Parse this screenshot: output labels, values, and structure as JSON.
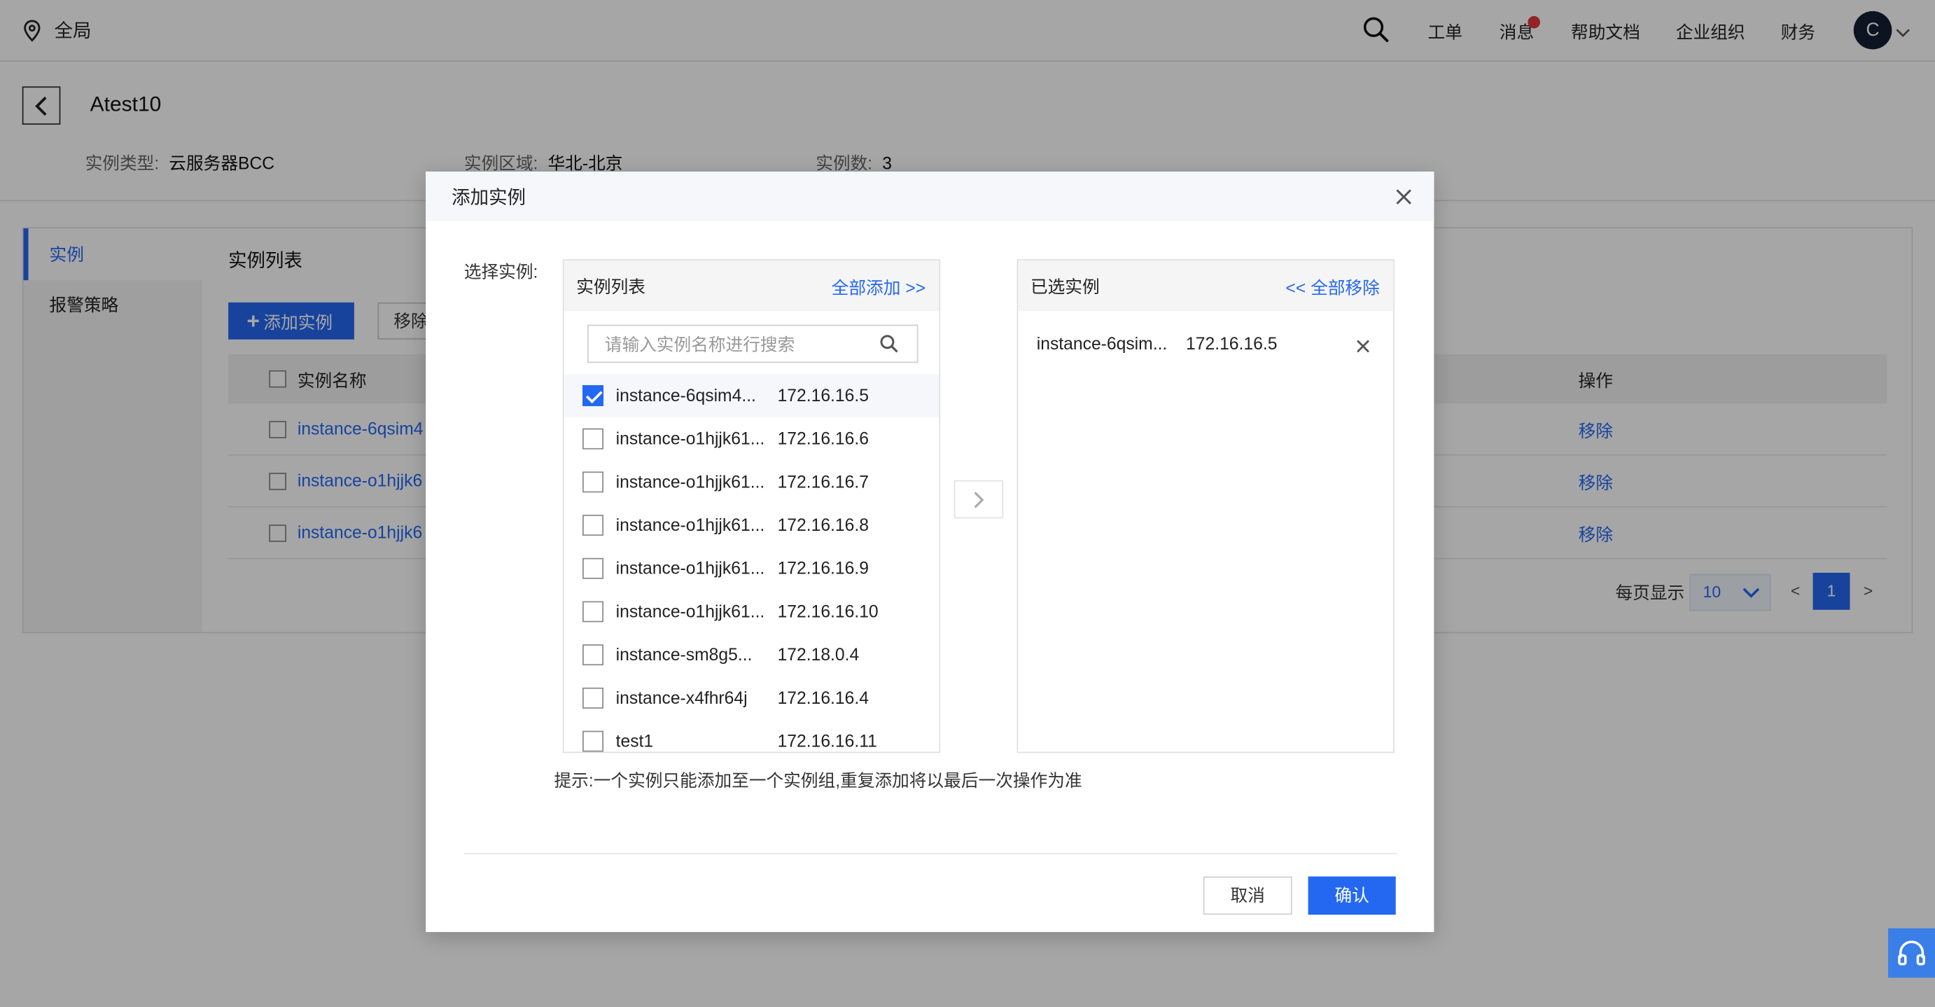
{
  "topbar": {
    "region": "全局",
    "nav": [
      "工单",
      "消息",
      "帮助文档",
      "企业组织",
      "财务"
    ],
    "avatar_letter": "C"
  },
  "page": {
    "title": "Atest10",
    "info": {
      "type_label": "实例类型:",
      "type_value": "云服务器BCC",
      "region_label": "实例区域:",
      "region_value": "华北-北京",
      "count_label": "实例数:",
      "count_value": "3"
    }
  },
  "sidebar": {
    "items": [
      {
        "label": "实例"
      },
      {
        "label": "报警策略"
      }
    ]
  },
  "main": {
    "title": "实例列表",
    "add_button": "添加实例",
    "remove_button": "移除",
    "table": {
      "headers": {
        "name": "实例名称",
        "action": "操作"
      },
      "rows": [
        {
          "name": "instance-6qsim4",
          "action": "移除"
        },
        {
          "name": "instance-o1hjjk6",
          "action": "移除"
        },
        {
          "name": "instance-o1hjjk6",
          "action": "移除"
        }
      ]
    },
    "pager": {
      "per_page_label": "每页显示",
      "per_page_value": "10",
      "prev": "<",
      "page": "1",
      "next": ">"
    }
  },
  "modal": {
    "title": "添加实例",
    "select_label": "选择实例:",
    "left_panel": {
      "title": "实例列表",
      "add_all": "全部添加 >>",
      "search_placeholder": "请输入实例名称进行搜索",
      "items": [
        {
          "name": "instance-6qsim4...",
          "ip": "172.16.16.5",
          "checked": true
        },
        {
          "name": "instance-o1hjjk61...",
          "ip": "172.16.16.6",
          "checked": false
        },
        {
          "name": "instance-o1hjjk61...",
          "ip": "172.16.16.7",
          "checked": false
        },
        {
          "name": "instance-o1hjjk61...",
          "ip": "172.16.16.8",
          "checked": false
        },
        {
          "name": "instance-o1hjjk61...",
          "ip": "172.16.16.9",
          "checked": false
        },
        {
          "name": "instance-o1hjjk61...",
          "ip": "172.16.16.10",
          "checked": false
        },
        {
          "name": "instance-sm8g5...",
          "ip": "172.18.0.4",
          "checked": false
        },
        {
          "name": "instance-x4fhr64j",
          "ip": "172.16.16.4",
          "checked": false
        },
        {
          "name": "test1",
          "ip": "172.16.16.11",
          "checked": false
        }
      ]
    },
    "right_panel": {
      "title": "已选实例",
      "remove_all": "<< 全部移除",
      "items": [
        {
          "name": "instance-6qsim...",
          "ip": "172.16.16.5"
        }
      ]
    },
    "tip": "提示:一个实例只能添加至一个实例组,重复添加将以最后一次操作为准",
    "cancel": "取消",
    "confirm": "确认"
  },
  "colors": {
    "accent": "#2468f2",
    "badge": "#e0383e",
    "avatar_bg": "#142034"
  }
}
